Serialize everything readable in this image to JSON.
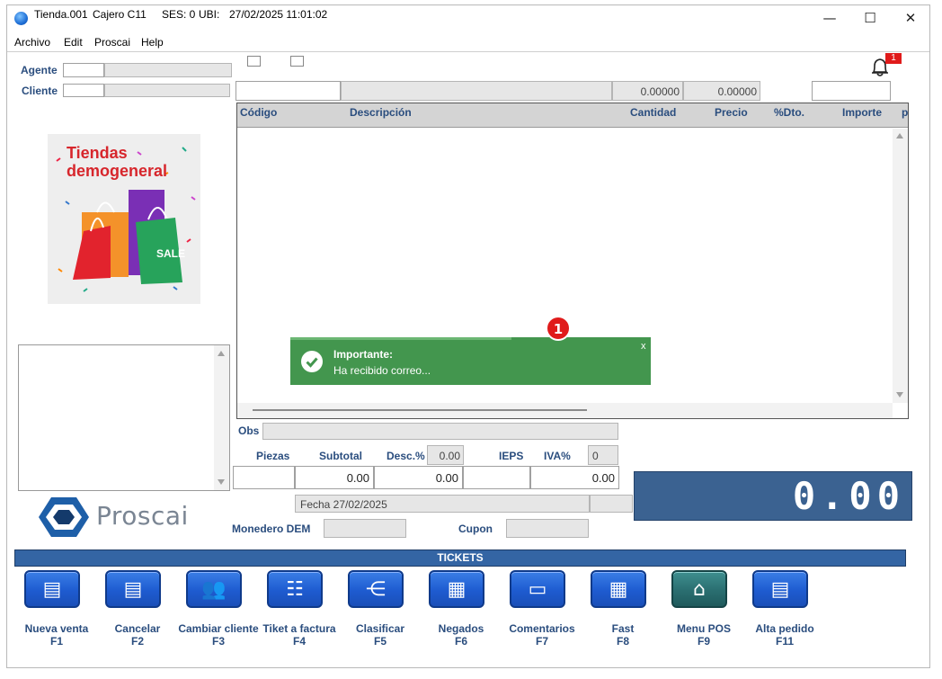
{
  "title_bar": {
    "store": "Tienda.001",
    "cashier": "Cajero C11",
    "session": "SES: 0",
    "location": "UBI:",
    "datetime": "27/02/2025 11:01:02"
  },
  "window_controls": {
    "minimize": "—",
    "maximize": "☐",
    "close": "✕"
  },
  "menu": [
    "Archivo",
    "Edit",
    "Proscai",
    "Help"
  ],
  "left": {
    "agent_label": "Agente",
    "client_label": "Cliente",
    "promo": {
      "line1": "Tiendas",
      "line2": "demogeneral",
      "sale": "SALE"
    },
    "logo_text": "Proscai"
  },
  "notifications": {
    "count": "1"
  },
  "entry": {
    "qty": "0.00000",
    "price": "0.00000"
  },
  "table": {
    "columns": [
      "Código",
      "Descripción",
      "Cantidad",
      "Precio",
      "%Dto.",
      "Importe",
      "p"
    ]
  },
  "toast": {
    "badge": "1",
    "title": "Importante:",
    "message": "Ha recibido correo...",
    "close": "x"
  },
  "summary": {
    "obs_label": "Obs",
    "piezas_label": "Piezas",
    "subtotal_label": "Subtotal",
    "desc_label": "Desc.%",
    "desc_value": "0.00",
    "ieps_label": "IEPS",
    "iva_label": "IVA%",
    "iva_rate": "0",
    "subtotal_value": "0.00",
    "desc_amount": "0.00",
    "iva_amount": "0.00",
    "fecha": "Fecha 27/02/2025",
    "monedero_label": "Monedero DEM",
    "cupon_label": "Cupon",
    "total_display": "0.00"
  },
  "tickets_header": "TICKETS",
  "function_buttons": [
    {
      "label": "Nueva venta",
      "key": "F1",
      "icon": "document-spark-icon"
    },
    {
      "label": "Cancelar",
      "key": "F2",
      "icon": "document-x-icon"
    },
    {
      "label": "Cambiar cliente",
      "key": "F3",
      "icon": "users-icon"
    },
    {
      "label": "Tiket a factura",
      "key": "F4",
      "icon": "invoice-icon"
    },
    {
      "label": "Clasificar",
      "key": "F5",
      "icon": "tree-icon"
    },
    {
      "label": "Negados",
      "key": "F6",
      "icon": "grid-icon"
    },
    {
      "label": "Comentarios",
      "key": "F7",
      "icon": "comment-icon"
    },
    {
      "label": "Fast",
      "key": "F8",
      "icon": "fast-grid-icon"
    },
    {
      "label": "Menu POS",
      "key": "F9",
      "icon": "home-icon"
    },
    {
      "label": "Alta pedido",
      "key": "F11",
      "icon": "document-spark-icon"
    }
  ],
  "colors": {
    "label_blue": "#2a4d7e",
    "header_blue": "#3465a4",
    "toast_green": "#43964e",
    "badge_red": "#e01b1b",
    "display_blue": "#3b6291"
  }
}
